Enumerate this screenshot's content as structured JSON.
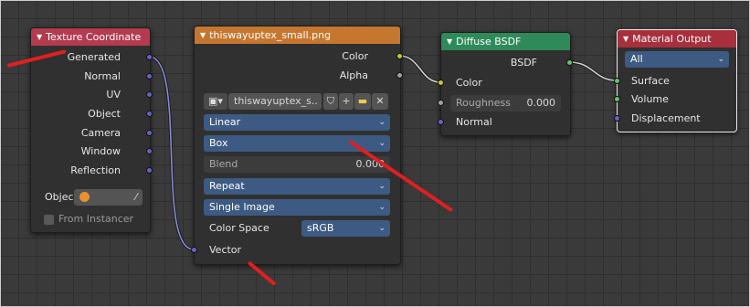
{
  "nodes": {
    "texture_coordinate": {
      "title": "Texture Coordinate",
      "outputs": [
        "Generated",
        "Normal",
        "UV",
        "Object",
        "Camera",
        "Window",
        "Reflection"
      ],
      "object_label": "Objec",
      "from_instancer_label": "From Instancer"
    },
    "image_texture": {
      "title": "thiswayuptex_small.png",
      "outputs": [
        "Color",
        "Alpha"
      ],
      "image_name": "thiswayuptex_s..",
      "interpolation": "Linear",
      "projection": "Box",
      "blend_label": "Blend",
      "blend_value": "0.000",
      "extension": "Repeat",
      "source": "Single Image",
      "color_space_label": "Color Space",
      "color_space_value": "sRGB",
      "input_vector": "Vector"
    },
    "diffuse_bsdf": {
      "title": "Diffuse BSDF",
      "output": "BSDF",
      "color_label": "Color",
      "roughness_label": "Roughness",
      "roughness_value": "0.000",
      "normal_label": "Normal"
    },
    "material_output": {
      "title": "Material Output",
      "target": "All",
      "inputs": [
        "Surface",
        "Volume",
        "Displacement"
      ]
    }
  },
  "colors": {
    "input_header": "#b33a4f",
    "texture_header": "#c6772f",
    "shader_header": "#2e8a59",
    "output_header": "#a8303d",
    "vector_socket": "#6363c7",
    "color_socket": "#c7c729",
    "shader_socket": "#63c763",
    "annotation": "#e11f1f"
  }
}
